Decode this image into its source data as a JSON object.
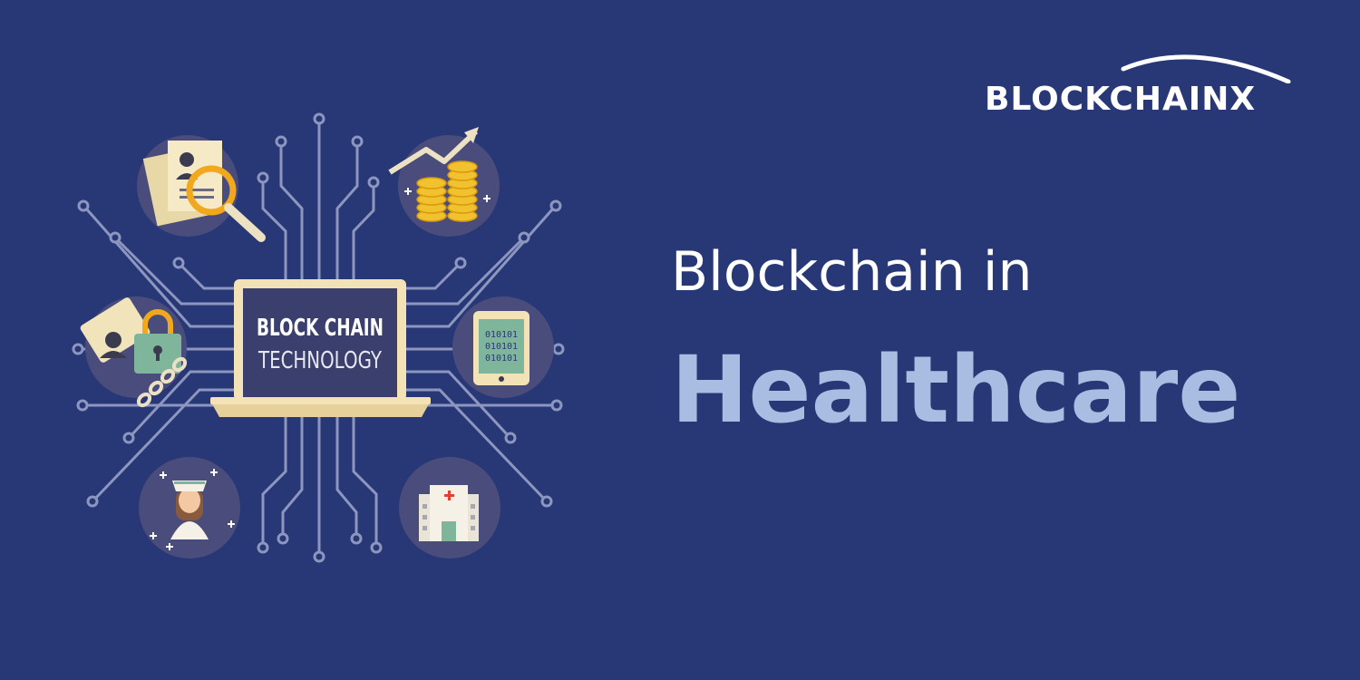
{
  "brand": {
    "name": "BLOCKCHAINX"
  },
  "headline": {
    "line1": "Blockchain in",
    "line2": "Healthcare"
  },
  "laptop": {
    "line1": "BLOCK CHAIN",
    "line2": "TECHNOLOGY"
  },
  "tablet": {
    "binary": [
      "010101",
      "010101",
      "010101"
    ]
  },
  "colors": {
    "background": "#283876",
    "circuit": "#8c96bf",
    "icon_circle": "#4a4d7c",
    "headline_accent": "#a9bde3",
    "coin": "#f2c12e",
    "laptop_body": "#f3e2b6",
    "laptop_screen": "#3b3f6e"
  },
  "icons": [
    "document-search-icon",
    "coins-growth-icon",
    "id-lock-icon",
    "tablet-data-icon",
    "nurse-icon",
    "hospital-icon"
  ]
}
